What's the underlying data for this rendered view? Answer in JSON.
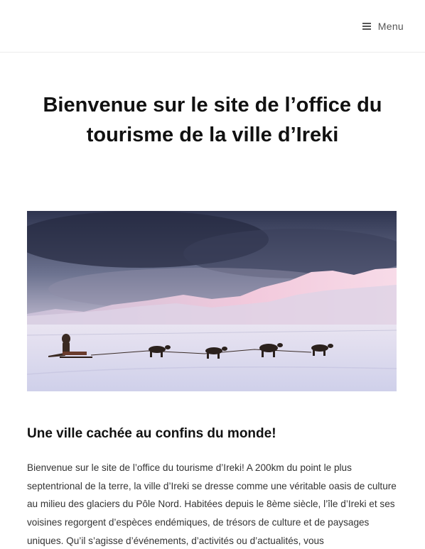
{
  "header": {
    "menu_label": "Menu",
    "menu_icon": "hamburger-icon"
  },
  "page": {
    "title": "Bienvenue sur le site de l’office du tourisme de la ville d’Ireki"
  },
  "hero": {
    "image_subject": "dog-sled-team-snow-landscape"
  },
  "content": {
    "heading": "Une ville cachée au confins du monde!",
    "intro": "Bienvenue sur le site de l’office du tourisme d’Ireki! A 200km du point le plus septentrional de la terre, la ville d’Ireki se dresse comme une véritable oasis de culture au milieu des glaciers du Pôle Nord. Habitées depuis le 8ème siècle, l’île d’Ireki et ses voisines regorgent d’espèces endémiques, de trésors de culture et de paysages uniques. Qu’il s’agisse d’événements, d’activités ou d’actualités, vous"
  }
}
